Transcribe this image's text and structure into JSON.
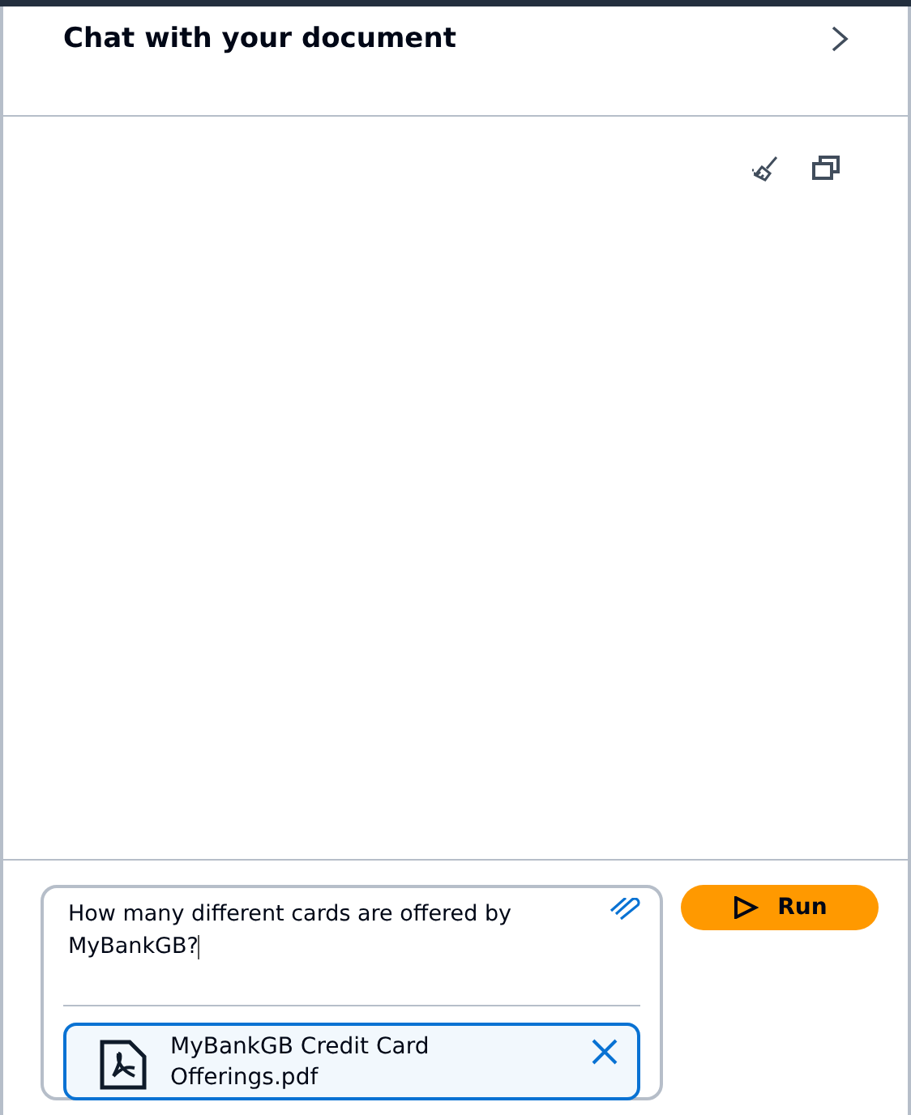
{
  "header": {
    "title": "Chat with your document"
  },
  "prompt": {
    "value": "How many different cards are offered by MyBankGB?"
  },
  "attachment": {
    "file_name": "MyBankGB Credit Card Offerings.pdf"
  },
  "run_button": {
    "label": "Run"
  }
}
